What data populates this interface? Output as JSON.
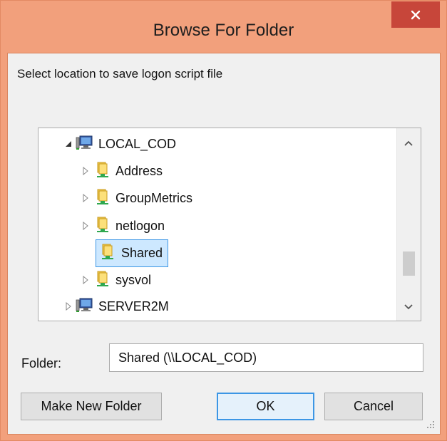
{
  "window": {
    "title": "Browse For Folder",
    "title_bg": "#F2A07C",
    "close_color": "#C7463A"
  },
  "instruction": "Select location to save logon script file",
  "tree": {
    "items": [
      {
        "label": "LOCAL_COD",
        "icon": "computer-icon",
        "expander": "expanded"
      },
      {
        "label": "Address",
        "icon": "shared-folder-icon",
        "expander": "collapsed"
      },
      {
        "label": "GroupMetrics",
        "icon": "shared-folder-icon",
        "expander": "collapsed"
      },
      {
        "label": "netlogon",
        "icon": "shared-folder-icon",
        "expander": "collapsed"
      },
      {
        "label": "Shared",
        "icon": "shared-folder-icon",
        "expander": "none",
        "selected": true
      },
      {
        "label": "sysvol",
        "icon": "shared-folder-icon",
        "expander": "collapsed"
      },
      {
        "label": "SERVER2M",
        "icon": "computer-icon",
        "expander": "collapsed"
      }
    ],
    "scroll_position": 0.72
  },
  "folder": {
    "label": "Folder:",
    "value": "Shared (\\\\LOCAL_COD)"
  },
  "buttons": {
    "make_new_folder": "Make New Folder",
    "ok": "OK",
    "cancel": "Cancel"
  },
  "colors": {
    "selection_bg": "#CDE8FF",
    "selection_border": "#3C96E5"
  }
}
